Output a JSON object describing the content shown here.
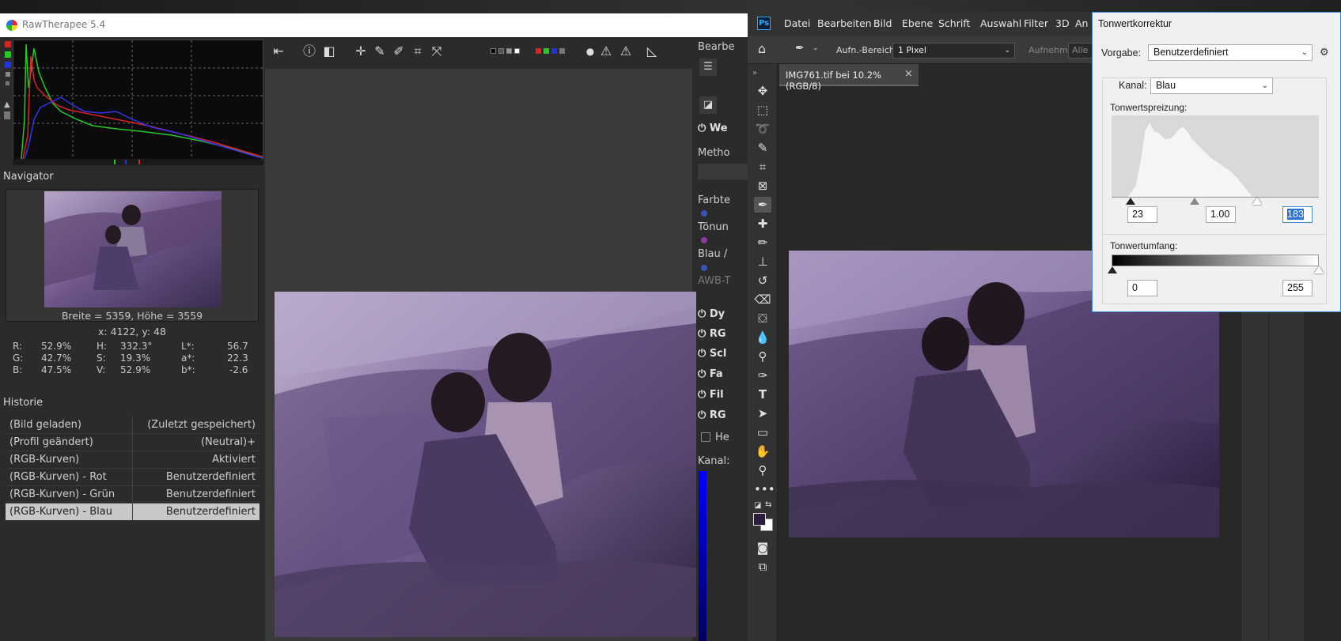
{
  "rawtherapee": {
    "title": "RawTherapee 5.4",
    "navigator": {
      "label": "Navigator",
      "size_text": "Breite = 5359, Höhe = 3559",
      "coords_text": "x: 4122, y: 48",
      "readouts": {
        "r_label": "R:",
        "r_value": "52.9%",
        "g_label": "G:",
        "g_value": "42.7%",
        "b_label": "B:",
        "b_value": "47.5%",
        "h_label": "H:",
        "h_value": "332.3°",
        "s_label": "S:",
        "s_value": "19.3%",
        "v_label": "V:",
        "v_value": "52.9%",
        "l_label": "L*:",
        "l_value": "56.7",
        "a_label": "a*:",
        "a_value": "22.3",
        "bs_label": "b*:",
        "bs_value": "-2.6"
      }
    },
    "history": {
      "label": "Historie",
      "rows": [
        {
          "action": "(Bild geladen)",
          "value": "(Zuletzt gespeichert)"
        },
        {
          "action": "(Profil geändert)",
          "value": "(Neutral)+"
        },
        {
          "action": "(RGB-Kurven)",
          "value": "Aktiviert"
        },
        {
          "action": "(RGB-Kurven) - Rot",
          "value": "Benutzerdefiniert"
        },
        {
          "action": "(RGB-Kurven) - Grün",
          "value": "Benutzerdefiniert"
        },
        {
          "action": "(RGB-Kurven) - Blau",
          "value": "Benutzerdefiniert"
        }
      ]
    },
    "right_panel": {
      "bearbe": "Bearbe",
      "we": "We",
      "method": "Metho",
      "farbte": "Farbte",
      "tonung": "Tönun",
      "blau": "Blau /",
      "awb": "AWB-T",
      "dy": "Dy",
      "rg1": "RG",
      "sc": "Scl",
      "fa": "Fa",
      "fil": "Fil",
      "rg2": "RG",
      "he": "He",
      "kanal": "Kanal:"
    }
  },
  "photoshop": {
    "logo": "Ps",
    "menu": [
      "Datei",
      "Bearbeiten",
      "Bild",
      "Ebene",
      "Schrift",
      "Auswahl",
      "Filter",
      "3D",
      "An"
    ],
    "options": {
      "sample_label": "Aufn.-Bereich:",
      "sample_value": "1 Pixel",
      "aufnehm": "Aufnehm.:",
      "alle": "Alle E"
    },
    "doc_tab": "IMG761.tif bei 10.2% (RGB/8)",
    "doc_close": "×"
  },
  "levels": {
    "title": "Tonwertkorrektur",
    "preset_label": "Vorgabe:",
    "preset_value": "Benutzerdefiniert",
    "channel_label": "Kanal:",
    "channel_value": "Blau",
    "input_label": "Tonwertspreizung:",
    "input_black": "23",
    "input_gamma": "1.00",
    "input_white": "183",
    "output_label": "Tonwertumfang:",
    "output_black": "0",
    "output_white": "255"
  },
  "colors": {
    "rt_bg": "#2b2b2b",
    "ps_bg": "#282828",
    "dialog_bg": "#f0f0f0",
    "selection": "#2a6fd6"
  }
}
